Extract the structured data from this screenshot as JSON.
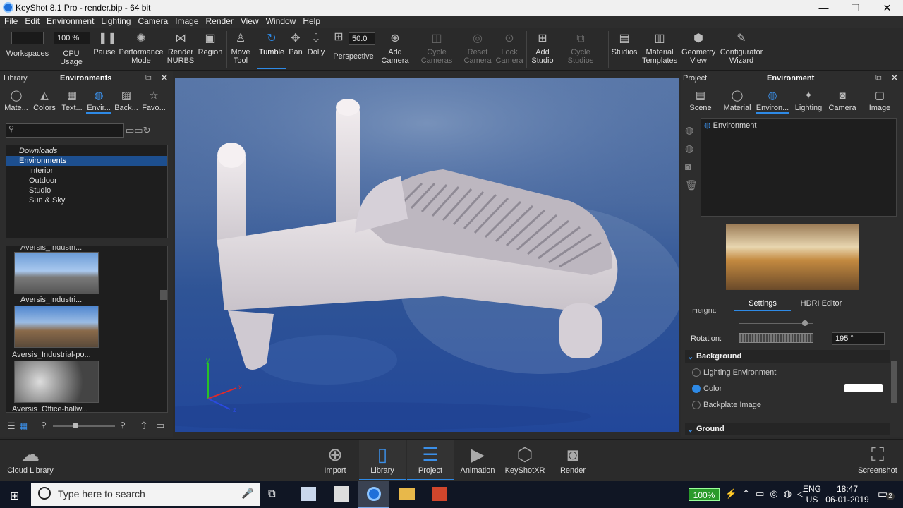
{
  "window": {
    "title": "KeyShot 8.1 Pro  - render.bip  - 64 bit",
    "minimize": "—",
    "maximize": "❐",
    "close": "✕"
  },
  "menu": [
    "File",
    "Edit",
    "Environment",
    "Lighting",
    "Camera",
    "Image",
    "Render",
    "View",
    "Window",
    "Help"
  ],
  "toolbar": {
    "cpu_value": "100 %",
    "perspective_value": "50.0",
    "items": {
      "workspaces": "Workspaces",
      "cpu": "CPU Usage",
      "pause": "Pause",
      "performance": "Performance\nMode",
      "render_nurbs": "Render\nNURBS",
      "region": "Region",
      "move": "Move\nTool",
      "tumble": "Tumble",
      "pan": "Pan",
      "dolly": "Dolly",
      "perspective": "Perspective",
      "add_camera": "Add\nCamera",
      "cycle_cameras": "Cycle\nCameras",
      "reset_camera": "Reset\nCamera",
      "lock_camera": "Lock\nCamera",
      "add_studio": "Add\nStudio",
      "cycle_studios": "Cycle\nStudios",
      "studios": "Studios",
      "material_templates": "Material\nTemplates",
      "geometry_view": "Geometry\nView",
      "configurator": "Configurator\nWizard"
    }
  },
  "library": {
    "label": "Library",
    "title": "Environments",
    "tabs": [
      "Mate...",
      "Colors",
      "Text...",
      "Envir...",
      "Back...",
      "Favo..."
    ],
    "tree": {
      "downloads": "Downloads",
      "environments": "Environments",
      "interior": "Interior",
      "outdoor": "Outdoor",
      "studio": "Studio",
      "sun": "Sun & Sky"
    },
    "thumbs": {
      "top_label": "Aversis_Industri...",
      "t1": "Aversis_Industri...",
      "t2": "Aversis_Industrial-po...",
      "t3": "Aversis_Office-hallw..."
    }
  },
  "project": {
    "label": "Project",
    "title": "Environment",
    "tabs": [
      "Scene",
      "Material",
      "Environ...",
      "Lighting",
      "Camera",
      "Image"
    ],
    "env_item": "Environment",
    "subtabs": {
      "settings": "Settings",
      "hdri": "HDRI Editor"
    },
    "height_label": "Height:",
    "rotation_label": "Rotation:",
    "rotation_value": "195 °",
    "background": {
      "title": "Background",
      "lighting": "Lighting Environment",
      "color": "Color",
      "backplate": "Backplate Image"
    },
    "ground": "Ground"
  },
  "axes": {
    "x": "x",
    "y": "y",
    "z": "z"
  },
  "bottombar": {
    "cloud": "Cloud Library",
    "import": "Import",
    "library": "Library",
    "project": "Project",
    "animation": "Animation",
    "keyshotxr": "KeyShotXR",
    "render": "Render",
    "screenshot": "Screenshot"
  },
  "taskbar": {
    "search": "Type here to search",
    "battery": "100%",
    "lang1": "ENG",
    "lang2": "US",
    "time": "18:47",
    "date": "06-01-2019",
    "notif": "2"
  }
}
